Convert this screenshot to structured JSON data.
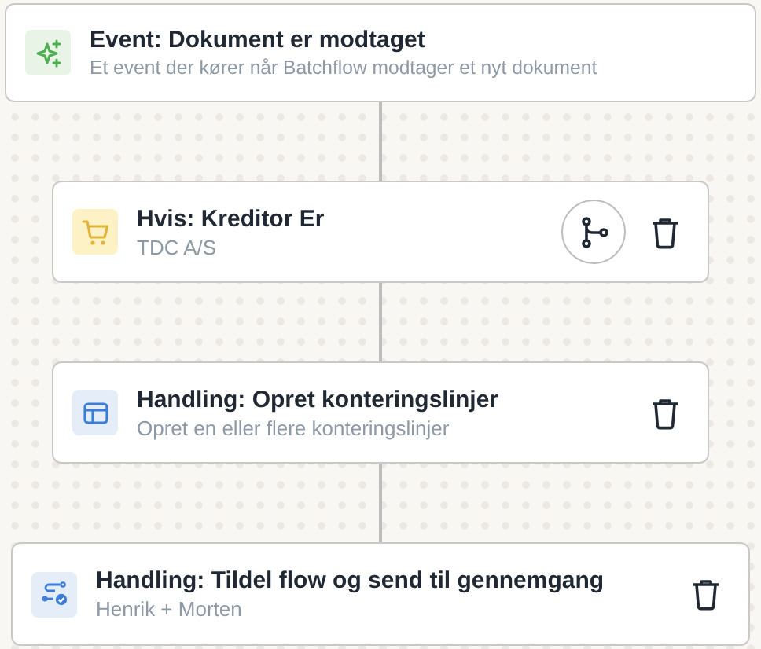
{
  "nodes": [
    {
      "kind": "event",
      "title": "Event: Dokument er modtaget",
      "subtitle": "Et event der kører når Batchflow modtager et nyt dokument"
    },
    {
      "kind": "condition",
      "title": "Hvis: Kreditor Er",
      "subtitle": "TDC A/S",
      "actions": [
        {
          "kind": "branch"
        },
        {
          "kind": "delete"
        }
      ]
    },
    {
      "kind": "action",
      "title": "Handling: Opret konteringslinjer",
      "subtitle": "Opret en eller flere konteringslinjer",
      "actions": [
        {
          "kind": "delete"
        }
      ]
    },
    {
      "kind": "assign",
      "title": "Handling: Tildel flow og send til gennemgang",
      "subtitle": "Henrik + Morten",
      "actions": [
        {
          "kind": "delete"
        }
      ]
    }
  ]
}
